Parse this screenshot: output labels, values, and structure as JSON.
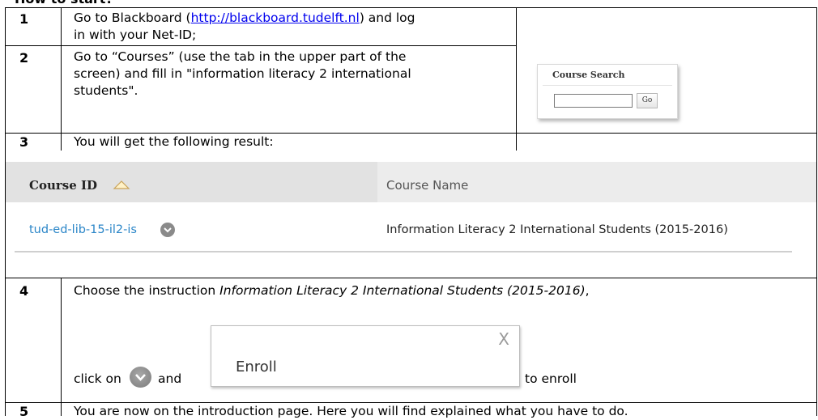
{
  "heading": "How to start?",
  "rows": [
    {
      "number": "1",
      "line1_before": "Go to Blackboard (",
      "link": "http://blackboard.tudelft.nl",
      "line1_after": ") and log",
      "line2": "in with your Net-ID;"
    },
    {
      "number": "2",
      "line1": "Go to “Courses” (use the tab in the upper part of the",
      "line2": "screen) and fill in \"information literacy 2 international",
      "line3": "students\"."
    },
    {
      "number": "3",
      "text": "You will get the following result:"
    },
    {
      "number": "4",
      "line1_before": "Choose the instruction ",
      "line1_italic": "Information Literacy 2 International Students (2015-2016)",
      "line1_after": ",",
      "click_on": "click on",
      "and": "and",
      "to_enroll": "to enroll"
    },
    {
      "number": "5",
      "text": "You are now on the introduction page. Here you will find explained what you have to do."
    }
  ],
  "course_search": {
    "title": "Course Search",
    "go_label": "Go",
    "input_value": ""
  },
  "results": {
    "header_id": "Course ID",
    "header_name": "Course Name",
    "course_id": "tud-ed-lib-15-il2-is",
    "course_name": "Information Literacy 2 International Students (2015-2016)"
  },
  "enroll_popup": {
    "close": "X",
    "label": "Enroll"
  },
  "icons": {
    "sort": "sort-up-icon",
    "chevron": "chevron-down-circle-icon"
  },
  "colors": {
    "link": "#0000ee",
    "course_link": "#2b86c8"
  }
}
